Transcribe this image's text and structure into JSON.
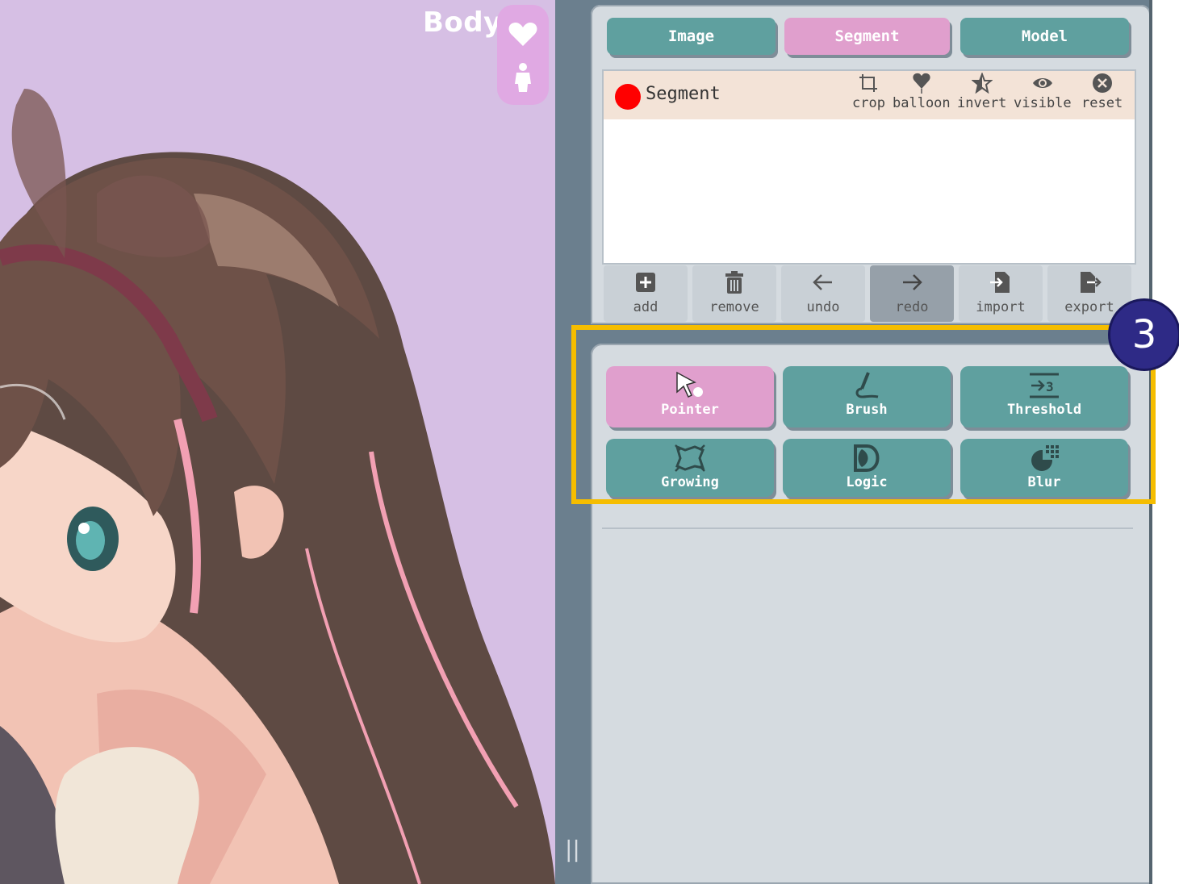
{
  "viewport": {
    "label": "Body",
    "side_icons": [
      "heart-icon",
      "person-icon"
    ]
  },
  "tabs": [
    {
      "label": "Image",
      "active": false
    },
    {
      "label": "Segment",
      "active": true
    },
    {
      "label": "Model",
      "active": false
    }
  ],
  "segment_list": {
    "items": [
      {
        "name": "Segment",
        "color": "#ff0000"
      }
    ],
    "actions": [
      {
        "label": "crop",
        "icon": "crop-icon"
      },
      {
        "label": "balloon",
        "icon": "balloon-icon"
      },
      {
        "label": "invert",
        "icon": "star-invert-icon"
      },
      {
        "label": "visible",
        "icon": "eye-icon"
      },
      {
        "label": "reset",
        "icon": "close-circle-icon"
      }
    ]
  },
  "toolbar": [
    {
      "label": "add",
      "icon": "plus-square-icon"
    },
    {
      "label": "remove",
      "icon": "trash-icon"
    },
    {
      "label": "undo",
      "icon": "arrow-left-icon"
    },
    {
      "label": "redo",
      "icon": "arrow-right-icon",
      "pressed": true
    },
    {
      "label": "import",
      "icon": "file-import-icon"
    },
    {
      "label": "export",
      "icon": "file-export-icon"
    }
  ],
  "tools": [
    {
      "label": "Pointer",
      "icon": "pointer-icon",
      "active": true
    },
    {
      "label": "Brush",
      "icon": "brush-icon",
      "active": false
    },
    {
      "label": "Threshold",
      "icon": "threshold-icon",
      "active": false
    },
    {
      "label": "Growing",
      "icon": "growing-icon",
      "active": false
    },
    {
      "label": "Logic",
      "icon": "logic-icon",
      "active": false
    },
    {
      "label": "Blur",
      "icon": "blur-icon",
      "active": false
    }
  ],
  "annotation": {
    "number": "3"
  },
  "colors": {
    "teal": "#5fa09f",
    "pink": "#e09fcd",
    "highlight": "#f5bd00",
    "badge": "#2e2a86"
  }
}
